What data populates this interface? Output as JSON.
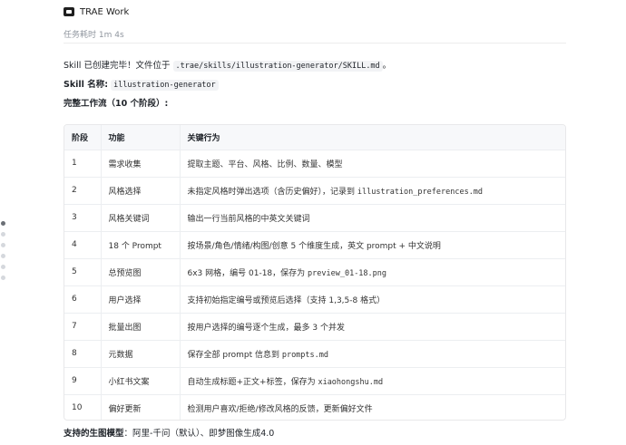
{
  "header": {
    "app_title": "TRAE Work",
    "logo_icon": "terminal-icon"
  },
  "task": {
    "time_label": "任务耗时 1m 4s"
  },
  "message": {
    "line1_prefix": "Skill 已创建完毕！文件位于 ",
    "line1_path": ".trae/skills/illustration-generator/SKILL.md",
    "line1_suffix": "。",
    "name_label": "Skill 名称:",
    "name_value": "illustration-generator",
    "workflow_title": "完整工作流（10 个阶段）:"
  },
  "table": {
    "headers": [
      "阶段",
      "功能",
      "关键行为"
    ],
    "rows": [
      {
        "stage": "1",
        "function": "需求收集",
        "behavior": "提取主题、平台、风格、比例、数量、模型"
      },
      {
        "stage": "2",
        "function": "风格选择",
        "behavior_prefix": "未指定风格时弹出选项（含历史偏好），记录到 ",
        "behavior_code": "illustration_preferences.md"
      },
      {
        "stage": "3",
        "function": "风格关键词",
        "behavior": "输出一行当前风格的中英文关键词"
      },
      {
        "stage": "4",
        "function": "18 个 Prompt",
        "behavior": "按场景/角色/情绪/构图/创意 5 个维度生成，英文 prompt + 中文说明"
      },
      {
        "stage": "5",
        "function": "总预览图",
        "behavior_prefix": "6x3 网格，编号 01-18，保存为 ",
        "behavior_code": "preview_01-18.png"
      },
      {
        "stage": "6",
        "function": "用户选择",
        "behavior": "支持初始指定编号或预览后选择（支持 1,3,5-8 格式）"
      },
      {
        "stage": "7",
        "function": "批量出图",
        "behavior": "按用户选择的编号逐个生成，最多 3 个并发"
      },
      {
        "stage": "8",
        "function": "元数据",
        "behavior_prefix": "保存全部 prompt 信息到 ",
        "behavior_code": "prompts.md"
      },
      {
        "stage": "9",
        "function": "小红书文案",
        "behavior_prefix": "自动生成标题+正文+标签，保存为 ",
        "behavior_code": "xiaohongshu.md"
      },
      {
        "stage": "10",
        "function": "偏好更新",
        "behavior": "检测用户喜欢/拒绝/修改风格的反馈，更新偏好文件"
      }
    ]
  },
  "footer": {
    "label": "支持的生图模型",
    "text": "：阿里-千问（默认）、即梦图像生成4.0"
  }
}
